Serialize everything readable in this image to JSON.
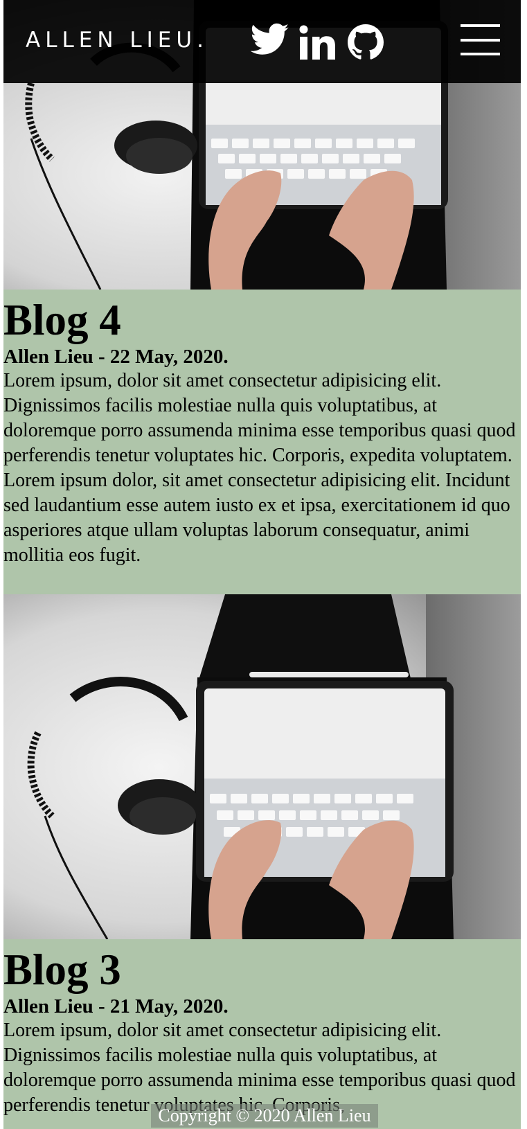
{
  "header": {
    "logo": "ALLEN LIEU.",
    "social_icons": [
      "twitter-icon",
      "linkedin-icon",
      "github-icon"
    ],
    "menu_icon": "hamburger-menu-icon"
  },
  "colors": {
    "header_bg": "#000000",
    "blog_bg": "#afc5aa",
    "footer_text": "#ffffff"
  },
  "posts": [
    {
      "image": "photo of hands typing on a tablet keyboard next to headphones on white fur",
      "title": "Blog 4",
      "meta": "Allen Lieu - 22 May, 2020.",
      "body": "Lorem ipsum, dolor sit amet consectetur adipisicing elit. Dignissimos facilis molestiae nulla quis voluptatibus, at doloremque porro assumenda minima esse temporibus quasi quod perferendis tenetur voluptates hic. Corporis, expedita voluptatem. Lorem ipsum dolor, sit amet consectetur adipisicing elit. Incidunt sed laudantium esse autem iusto ex et ipsa, exercitationem id quo asperiores atque ullam voluptas laborum consequatur, animi mollitia eos fugit."
    },
    {
      "image": "photo of hands typing on a tablet keyboard next to headphones on white fur",
      "title": "Blog 3",
      "meta": "Allen Lieu - 21 May, 2020.",
      "body": "Lorem ipsum, dolor sit amet consectetur adipisicing elit. Dignissimos facilis molestiae nulla quis voluptatibus, at doloremque porro assumenda minima esse temporibus quasi quod perferendis tenetur voluptates hic. Corporis,"
    }
  ],
  "footer": {
    "copyright": "Copyright © 2020 Allen Lieu"
  }
}
